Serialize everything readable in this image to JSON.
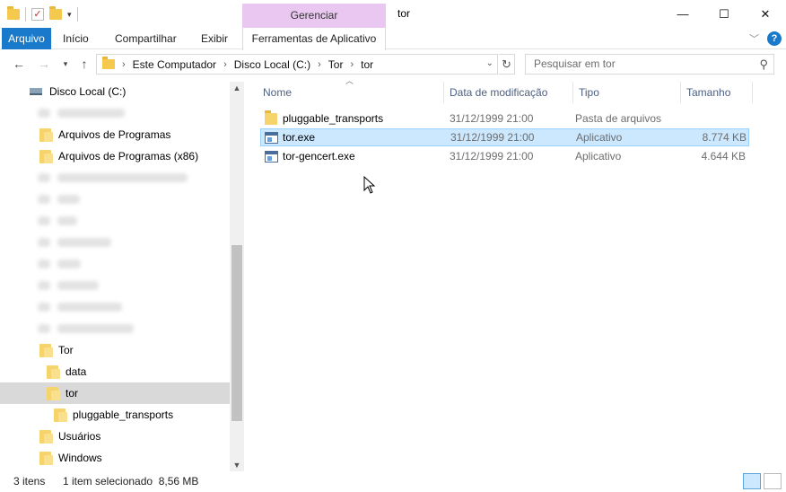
{
  "title_bar": {
    "window_title": "tor",
    "manage_tab_label": "Gerenciar",
    "minimize_symbol": "—",
    "maximize_symbol": "☐",
    "close_symbol": "✕"
  },
  "ribbon": {
    "tabs": [
      {
        "label": "Arquivo"
      },
      {
        "label": "Início"
      },
      {
        "label": "Compartilhar"
      },
      {
        "label": "Exibir"
      },
      {
        "label": "Ferramentas de Aplicativo"
      }
    ],
    "help_symbol": "?"
  },
  "address": {
    "crumbs": [
      "Este Computador",
      "Disco Local (C:)",
      "Tor",
      "tor"
    ],
    "search_placeholder": "Pesquisar em tor"
  },
  "nav_pane": {
    "items": [
      {
        "label": "Disco Local (C:)",
        "type": "drive"
      },
      {
        "label": "",
        "type": "blurred"
      },
      {
        "label": "Arquivos de Programas",
        "type": "folder"
      },
      {
        "label": "Arquivos de Programas (x86)",
        "type": "folder"
      },
      {
        "label": "",
        "type": "blurred"
      },
      {
        "label": "",
        "type": "blurred"
      },
      {
        "label": "",
        "type": "blurred"
      },
      {
        "label": "",
        "type": "blurred"
      },
      {
        "label": "",
        "type": "blurred"
      },
      {
        "label": "",
        "type": "blurred"
      },
      {
        "label": "",
        "type": "blurred"
      },
      {
        "label": "",
        "type": "blurred"
      },
      {
        "label": "Tor",
        "type": "folder"
      },
      {
        "label": "data",
        "type": "folder"
      },
      {
        "label": "tor",
        "type": "folder",
        "selected": true
      },
      {
        "label": "pluggable_transports",
        "type": "folder"
      },
      {
        "label": "Usuários",
        "type": "folder"
      },
      {
        "label": "Windows",
        "type": "folder"
      }
    ]
  },
  "content": {
    "columns": [
      "Nome",
      "Data de modificação",
      "Tipo",
      "Tamanho"
    ],
    "rows": [
      {
        "name": "pluggable_transports",
        "date": "31/12/1999 21:00",
        "type": "Pasta de arquivos",
        "size": "",
        "icon": "folder-icon",
        "selected": false
      },
      {
        "name": "tor.exe",
        "date": "31/12/1999 21:00",
        "type": "Aplicativo",
        "size": "8.774 KB",
        "icon": "exe-icon",
        "selected": true
      },
      {
        "name": "tor-gencert.exe",
        "date": "31/12/1999 21:00",
        "type": "Aplicativo",
        "size": "4.644 KB",
        "icon": "exe-icon",
        "selected": false
      }
    ]
  },
  "status_bar": {
    "item_count": "3 itens",
    "selection": "1 item selecionado  8,56 MB"
  },
  "colors": {
    "file_tab": "#1979ca",
    "manage_tab": "#e9c7f0",
    "selection": "#cce8ff",
    "nav_selected": "#d9d9d9"
  }
}
